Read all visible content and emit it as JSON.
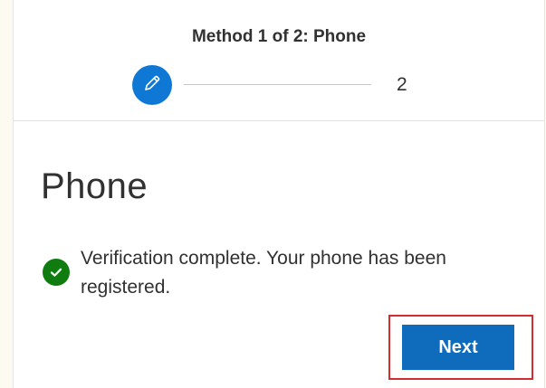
{
  "header": {
    "method_title": "Method 1 of 2: Phone",
    "steps": [
      {
        "icon": "pencil-icon",
        "state": "current"
      },
      {
        "label": "2",
        "state": "upcoming"
      }
    ]
  },
  "content": {
    "title": "Phone",
    "status_icon": "checkmark-icon",
    "status_message": "Verification complete. Your phone has been registered."
  },
  "actions": {
    "next_label": "Next"
  },
  "colors": {
    "accent": "#0f78d4",
    "button": "#0f6cbd",
    "success": "#107c10",
    "highlight": "#d12f2f"
  }
}
